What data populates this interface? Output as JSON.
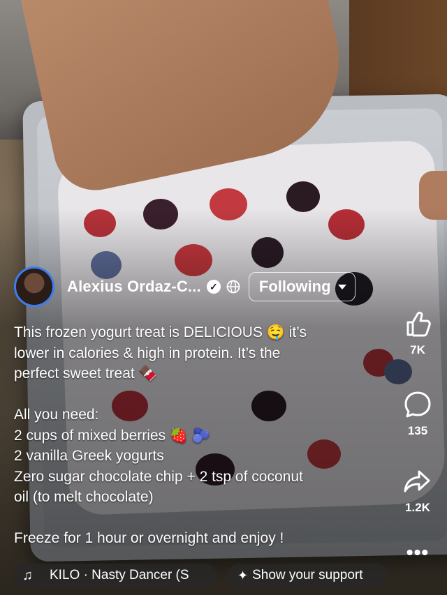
{
  "author": {
    "name": "Alexius Ordaz-C...",
    "follow_label": "Following"
  },
  "caption": {
    "lines": [
      "This frozen yogurt treat is DELICIOUS 🤤  it’s",
      "lower in calories & high in protein. It’s the",
      "perfect sweet treat 🍫",
      "",
      "All you need:",
      "2 cups of mixed berries 🍓 🫐",
      "2 vanilla Greek yogurts",
      "Zero sugar chocolate chip + 2 tsp of coconut",
      "oil (to melt chocolate)",
      "",
      "Freeze for 1 hour or overnight and enjoy !"
    ]
  },
  "actions": {
    "likes": "7K",
    "comments": "135",
    "shares": "1.2K",
    "more": "•••"
  },
  "music": {
    "track": "KILO · Nasty Dancer (S"
  },
  "support": {
    "label": "Show your support"
  },
  "colors": {
    "accent": "#3d7cf0"
  }
}
